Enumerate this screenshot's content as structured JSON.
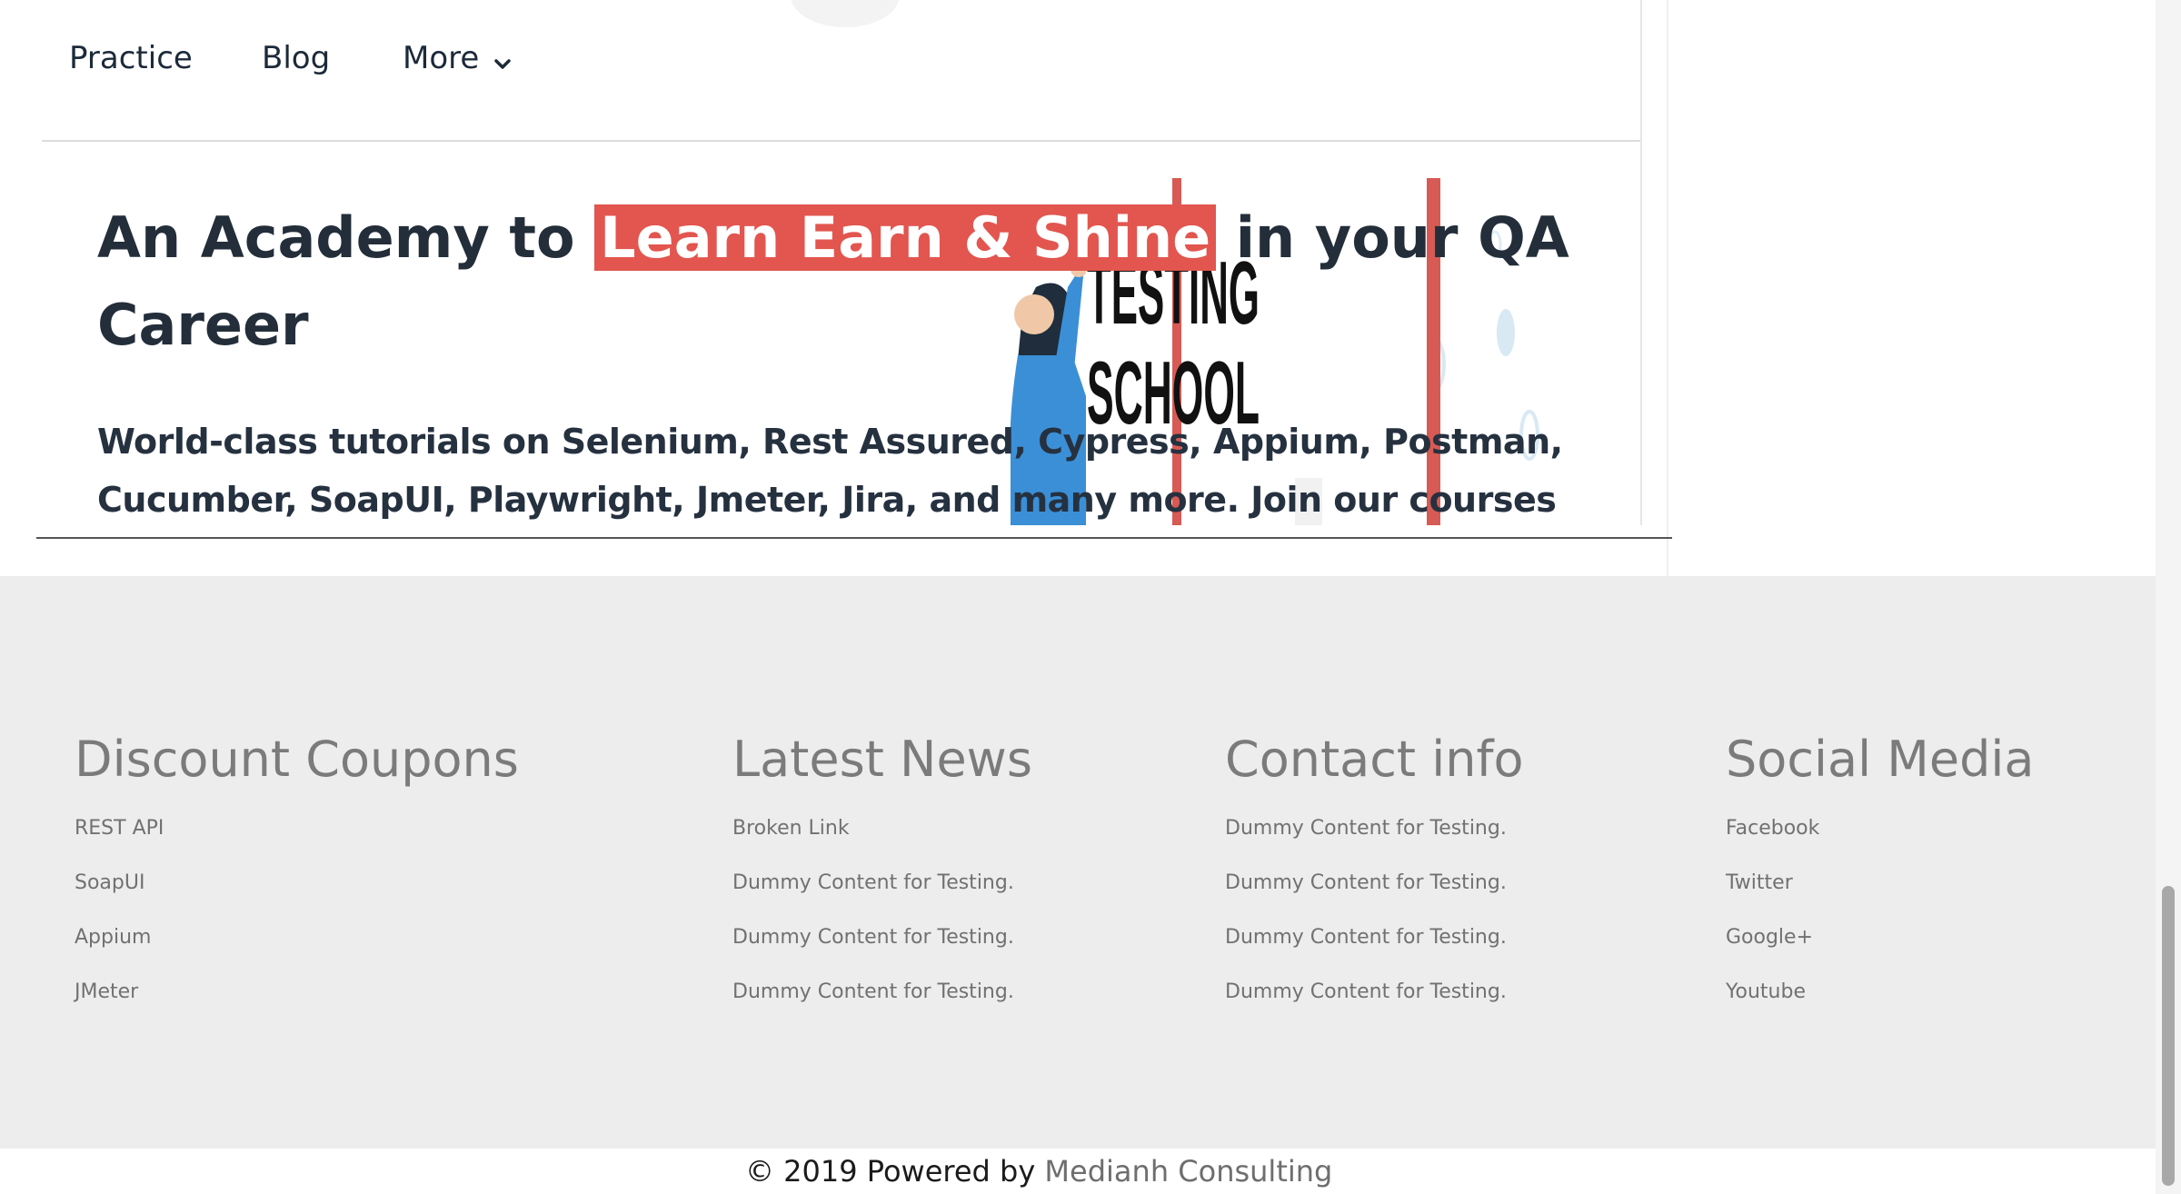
{
  "nav": {
    "items": [
      {
        "label": "Practice"
      },
      {
        "label": "Blog"
      },
      {
        "label": "More"
      }
    ]
  },
  "hero": {
    "headline_pre": "An Academy to ",
    "headline_highlight": "Learn Earn & Shine",
    "headline_post": "  in your QA Career",
    "subtext": "World-class tutorials on Selenium, Rest Assured, Cypress, Appium, Postman, Cucumber, SoapUI, Playwright, Jmeter, Jira, and many more. Join our courses now to get the best job",
    "board_line1": "TESTING",
    "board_line2": "SCHOOL",
    "highlight_color": "#e2564f"
  },
  "footer": {
    "columns": [
      {
        "title": "Discount Coupons",
        "items": [
          "REST API",
          "SoapUI",
          "Appium",
          "JMeter"
        ]
      },
      {
        "title": "Latest News",
        "items": [
          "Broken Link",
          "Dummy Content for Testing.",
          "Dummy Content for Testing.",
          "Dummy Content for Testing."
        ]
      },
      {
        "title": "Contact info",
        "items": [
          "Dummy Content for Testing.",
          "Dummy Content for Testing.",
          "Dummy Content for Testing.",
          "Dummy Content for Testing."
        ]
      },
      {
        "title": "Social Media",
        "items": [
          "Facebook",
          "Twitter",
          "Google+",
          "Youtube"
        ]
      }
    ]
  },
  "copyright": {
    "prefix": "© 2019 Powered by ",
    "link": "Medianh Consulting"
  }
}
